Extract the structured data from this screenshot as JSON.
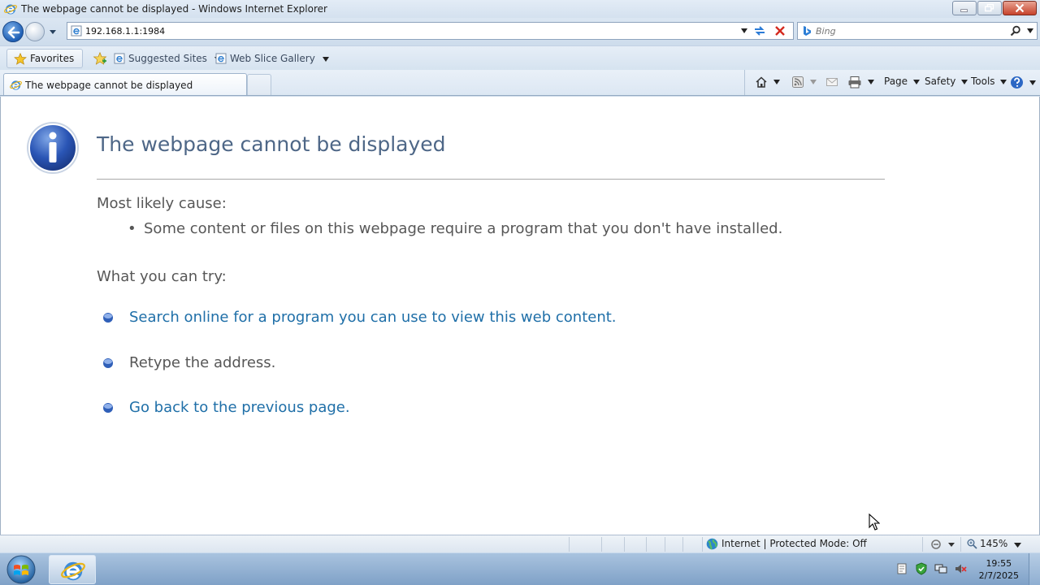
{
  "window": {
    "title": "The webpage cannot be displayed - Windows Internet Explorer"
  },
  "navigation": {
    "address": "192.168.1.1:1984",
    "search_placeholder": "Bing"
  },
  "favorites_bar": {
    "favorites_label": "Favorites",
    "links": [
      {
        "label": "Suggested Sites"
      },
      {
        "label": "Web Slice Gallery"
      }
    ]
  },
  "tabs": [
    {
      "label": "The webpage cannot be displayed"
    }
  ],
  "command_bar": {
    "page_label": "Page",
    "safety_label": "Safety",
    "tools_label": "Tools"
  },
  "error_page": {
    "title": "The webpage cannot be displayed",
    "cause_heading": "Most likely cause:",
    "cause_items": [
      "Some content or files on this webpage require a program that you don't have installed."
    ],
    "bullet_glyph": "•",
    "try_heading": "What you can try:",
    "try_items": [
      {
        "text": "Search online for a program you can use to view this web content.",
        "is_link": true
      },
      {
        "text": "Retype the address.",
        "is_link": false
      },
      {
        "text": "Go back to the previous page.",
        "is_link": true
      }
    ]
  },
  "status_bar": {
    "zone": "Internet | Protected Mode: Off",
    "zoom": "145%"
  },
  "taskbar": {
    "time": "19:55",
    "date": "2/7/2025"
  },
  "colors": {
    "link": "#1f6fa8",
    "title": "#4e6787",
    "body_text": "#575757"
  }
}
